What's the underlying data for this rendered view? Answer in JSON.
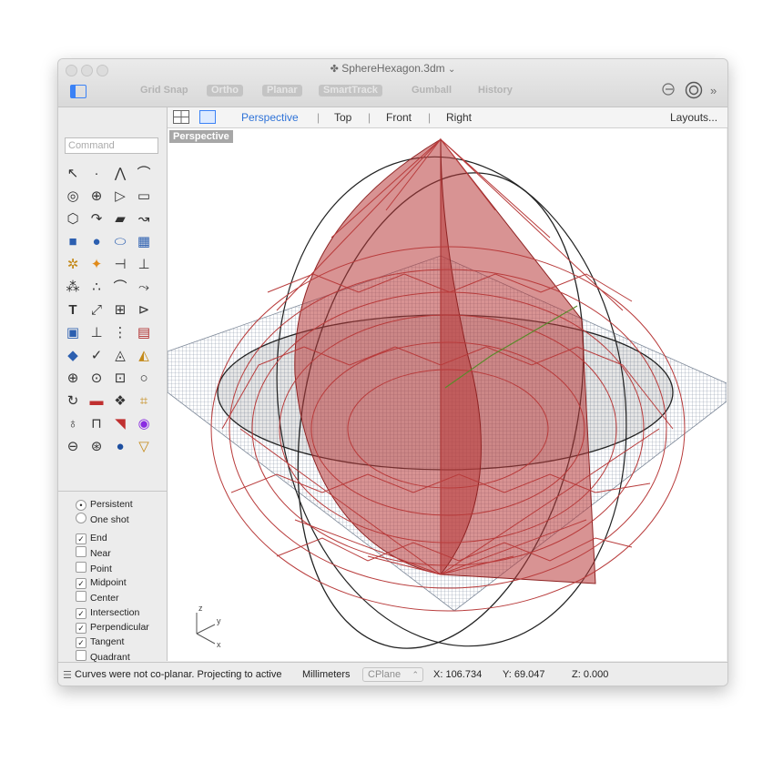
{
  "window": {
    "title": "SphereHexagon.3dm",
    "title_icon": "rhino-icon",
    "title_chevron": "⌄"
  },
  "toolbar": {
    "grid_snap": "Grid Snap",
    "ortho": "Ortho",
    "planar": "Planar",
    "smarttrack": "SmartTrack",
    "gumball": "Gumball",
    "history": "History",
    "overflow": "»"
  },
  "command": {
    "placeholder": "Command"
  },
  "view_tabs": {
    "perspective": "Perspective",
    "top": "Top",
    "front": "Front",
    "right": "Right",
    "layouts": "Layouts..."
  },
  "viewport": {
    "label": "Perspective",
    "axis_z": "z",
    "axis_y": "y",
    "axis_x": "x"
  },
  "osnap": {
    "persistent": "Persistent",
    "one_shot": "One shot",
    "end": "End",
    "near": "Near",
    "point": "Point",
    "midpoint": "Midpoint",
    "center": "Center",
    "intersection": "Intersection",
    "perpendicular": "Perpendicular",
    "tangent": "Tangent",
    "quadrant": "Quadrant"
  },
  "status": {
    "message": "Curves were not co-planar. Projecting to active",
    "units": "Millimeters",
    "cplane": "CPlane",
    "x": "X: 106.734",
    "y": "Y: 69.047",
    "z": "Z: 0.000"
  },
  "colors": {
    "accent": "#3b82f6",
    "model_red": "#b83b3b",
    "grid": "#8a96a8"
  }
}
